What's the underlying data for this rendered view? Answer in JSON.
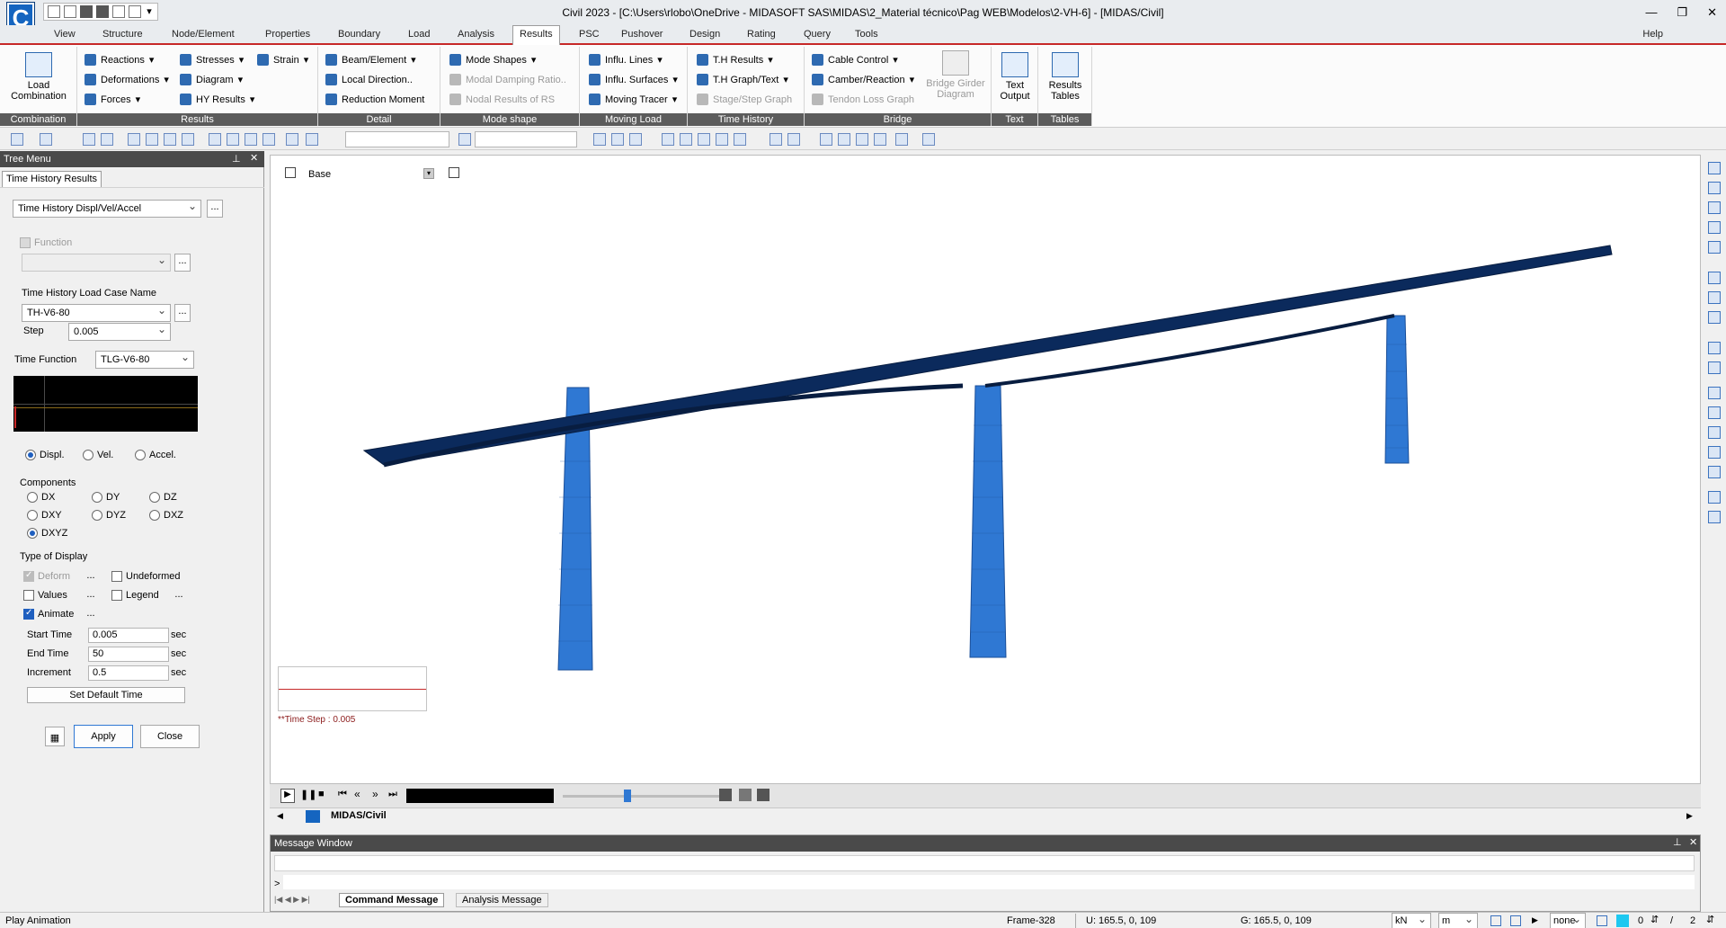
{
  "title": {
    "window_title": "Civil 2023 - [C:\\Users\\rlobo\\OneDrive - MIDASOFT SAS\\MIDAS\\2_Material técnico\\Pag WEB\\Modelos\\2-VH-6] - [MIDAS/Civil]",
    "logo_letter": "C"
  },
  "menu": {
    "tabs": [
      "View",
      "Structure",
      "Node/Element",
      "Properties",
      "Boundary",
      "Load",
      "Analysis",
      "Results",
      "PSC",
      "Pushover",
      "Design",
      "Rating",
      "Query",
      "Tools"
    ],
    "active_tab": "Results",
    "help": "Help"
  },
  "ribbon": {
    "combination": {
      "btn1": "Load",
      "btn2": "Combination",
      "label": "Combination"
    },
    "results": {
      "reactions": "Reactions",
      "deformations": "Deformations",
      "forces": "Forces",
      "stresses": "Stresses",
      "diagram": "Diagram",
      "hy_results": "HY Results",
      "strain": "Strain",
      "label": "Results"
    },
    "detail": {
      "beam": "Beam/Element",
      "local": "Local Direction..",
      "reduction": "Reduction Moment",
      "label": "Detail"
    },
    "mode": {
      "shapes": "Mode Shapes",
      "damping": "Modal Damping Ratio..",
      "nodal": "Nodal Results of RS",
      "label": "Mode shape"
    },
    "moving": {
      "lines": "Influ. Lines",
      "surfaces": "Influ. Surfaces",
      "tracer": "Moving Tracer",
      "label": "Moving Load"
    },
    "th": {
      "results": "T.H Results",
      "graph": "T.H Graph/Text",
      "stage": "Stage/Step Graph",
      "label": "Time History"
    },
    "bridge": {
      "cable": "Cable Control",
      "camber": "Camber/Reaction",
      "tendon": "Tendon Loss Graph",
      "girder1": "Bridge Girder",
      "girder2": "Diagram",
      "label": "Bridge"
    },
    "text": {
      "b1": "Text",
      "b2": "Output",
      "label": "Text"
    },
    "tables": {
      "b1": "Results",
      "b2": "Tables",
      "label": "Tables"
    }
  },
  "tree": {
    "header": "Tree Menu",
    "tab": "Time History Results",
    "result_type": "Time History Displ/Vel/Accel",
    "function_label": "Function",
    "load_case_label": "Time History Load Case Name",
    "load_case": "TH-V6-80",
    "step_label": "Step",
    "step": "0.005",
    "time_function_label": "Time Function",
    "time_function": "TLG-V6-80",
    "quantity": {
      "displ": "Displ.",
      "vel": "Vel.",
      "accel": "Accel.",
      "selected": "Displ."
    },
    "components_label": "Components",
    "components": [
      "DX",
      "DY",
      "DZ",
      "DXY",
      "DYZ",
      "DXZ",
      "DXYZ"
    ],
    "selected_component": "DXYZ",
    "display_label": "Type of Display",
    "deform": "Deform",
    "undeformed": "Undeformed",
    "values": "Values",
    "legend": "Legend",
    "animate": "Animate",
    "start_time_label": "Start Time",
    "start_time": "0.005",
    "end_time_label": "End Time",
    "end_time": "50",
    "increment_label": "Increment",
    "increment": "0.5",
    "unit": "sec",
    "default_btn": "Set Default Time",
    "apply": "Apply",
    "close": "Close"
  },
  "view": {
    "base_label": "Base",
    "time_step": "**Time Step : 0.005",
    "doc_tab": "MIDAS/Civil"
  },
  "messages": {
    "header": "Message Window",
    "prompt": ">",
    "tab1": "Command Message",
    "tab2": "Analysis Message"
  },
  "status": {
    "text": "Play Animation",
    "frame": "Frame-328",
    "u": "U: 165.5, 0, 109",
    "g": "G: 165.5, 0, 109",
    "force_unit": "kN",
    "length_unit": "m",
    "none": "none",
    "count0": "0",
    "count2": "2"
  },
  "colors": {
    "deck": "#0b2a5c",
    "pier": "#2f78d3",
    "accent": "#c62828"
  }
}
